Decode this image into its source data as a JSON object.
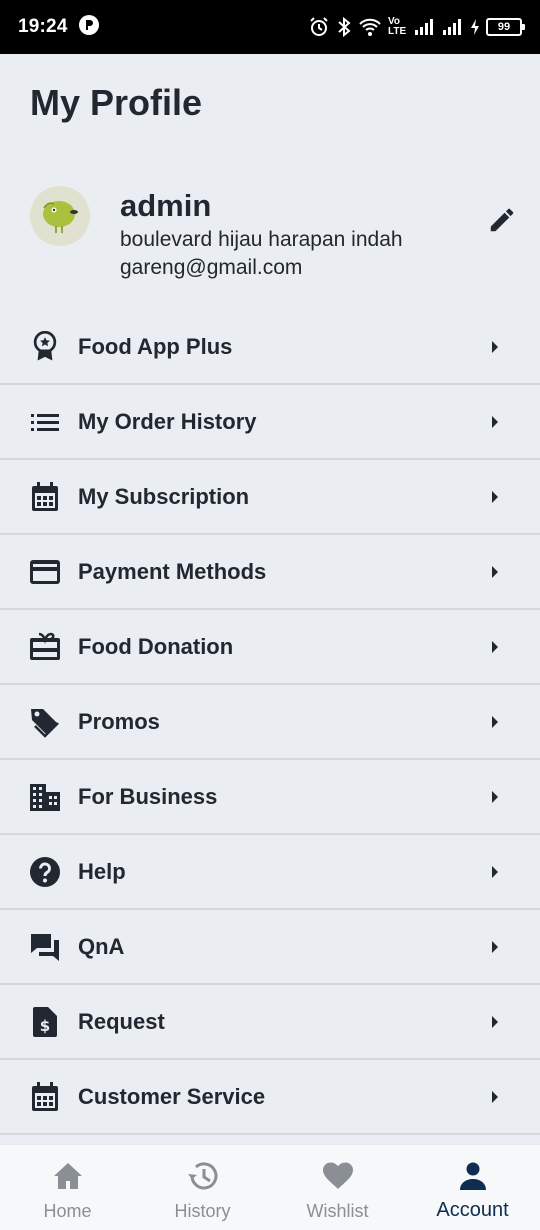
{
  "status_bar": {
    "time": "19:24",
    "battery": "99",
    "network": "Vo LTE"
  },
  "page": {
    "title": "My Profile"
  },
  "profile": {
    "name": "admin",
    "address": "boulevard hijau harapan indah",
    "email": "gareng@gmail.com",
    "edit_icon": "pencil-icon"
  },
  "menu": {
    "items": [
      {
        "label": "Food App Plus",
        "icon": "badge-star-icon"
      },
      {
        "label": "My Order History",
        "icon": "list-icon"
      },
      {
        "label": "My Subscription",
        "icon": "calendar-icon"
      },
      {
        "label": "Payment Methods",
        "icon": "credit-card-icon"
      },
      {
        "label": "Food Donation",
        "icon": "gift-card-icon"
      },
      {
        "label": "Promos",
        "icon": "tag-icon"
      },
      {
        "label": "For Business",
        "icon": "building-icon"
      },
      {
        "label": "Help",
        "icon": "question-circle-icon"
      },
      {
        "label": "QnA",
        "icon": "chat-bubbles-icon"
      },
      {
        "label": "Request",
        "icon": "dollar-document-icon"
      },
      {
        "label": "Customer Service",
        "icon": "calendar-icon"
      }
    ]
  },
  "bottom_nav": {
    "items": [
      {
        "label": "Home",
        "icon": "home-icon",
        "active": false
      },
      {
        "label": "History",
        "icon": "history-icon",
        "active": false
      },
      {
        "label": "Wishlist",
        "icon": "heart-icon",
        "active": false
      },
      {
        "label": "Account",
        "icon": "person-icon",
        "active": true
      }
    ]
  },
  "colors": {
    "background": "#eaedf1",
    "text": "#222831",
    "active_nav": "#0f2d4f",
    "inactive_nav": "#8a8f96",
    "divider": "#d4d8de"
  }
}
